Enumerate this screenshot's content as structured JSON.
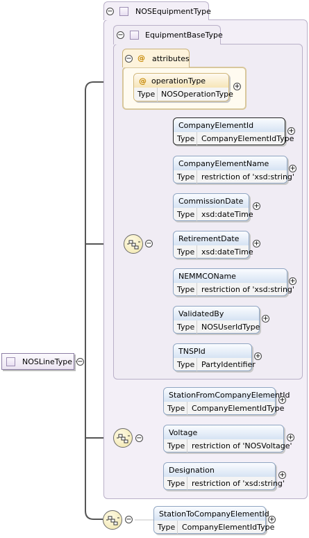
{
  "root": {
    "name": "NOSLineType"
  },
  "base_type": {
    "name": "NOSEquipmentType"
  },
  "inner_base_type": {
    "name": "EquipmentBaseType"
  },
  "attributes": {
    "label": "attributes",
    "items": [
      {
        "name": "operationType",
        "type_label": "Type",
        "type": "NOSOperationType"
      }
    ]
  },
  "sequence1": {
    "elements": [
      {
        "name": "CompanyElementId",
        "type_label": "Type",
        "type": "CompanyElementIdType"
      },
      {
        "name": "CompanyElementName",
        "type_label": "Type",
        "type": "restriction of 'xsd:string'"
      },
      {
        "name": "CommissionDate",
        "type_label": "Type",
        "type": "xsd:dateTime"
      },
      {
        "name": "RetirementDate",
        "type_label": "Type",
        "type": "xsd:dateTime"
      },
      {
        "name": "NEMMCOName",
        "type_label": "Type",
        "type": "restriction of 'xsd:string'"
      },
      {
        "name": "ValidatedBy",
        "type_label": "Type",
        "type": "NOSUserIdType"
      },
      {
        "name": "TNSPId",
        "type_label": "Type",
        "type": "PartyIdentifier"
      }
    ]
  },
  "sequence2": {
    "elements": [
      {
        "name": "StationFromCompanyElementId",
        "type_label": "Type",
        "type": "CompanyElementIdType"
      },
      {
        "name": "Voltage",
        "type_label": "Type",
        "type": "restriction of 'NOSVoltage'"
      },
      {
        "name": "Designation",
        "type_label": "Type",
        "type": "restriction of 'xsd:string'"
      }
    ]
  },
  "sequence3": {
    "elements": [
      {
        "name": "StationToCompanyElementId",
        "type_label": "Type",
        "type": "CompanyElementIdType"
      }
    ]
  },
  "glyphs": {
    "collapse": "⊖",
    "expand": "+",
    "minus": "−",
    "at": "@"
  }
}
